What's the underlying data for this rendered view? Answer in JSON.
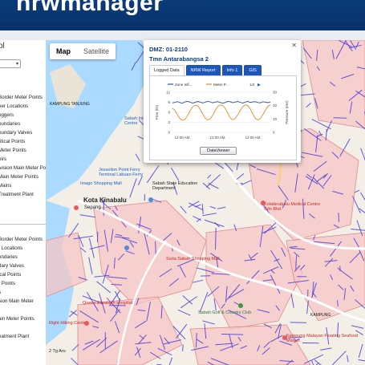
{
  "app": {
    "brand": "nrwmanager"
  },
  "sidebar": {
    "title": "ol",
    "section1": [
      "Border Meter Points",
      "her Locations",
      "oggers",
      "oundaries",
      "oundary Valves",
      "ritical Points",
      "Meter Points",
      "oirs",
      "ivision Main Meter Po",
      "Main Meter Points",
      "Mains",
      "Treatment Plant"
    ],
    "section2": [
      "Border Meter Points",
      "r Locations",
      "undaries",
      "dary Valves",
      "ical Points",
      "r Points",
      "s",
      "sion Main Meter",
      "",
      "ain Meter Points",
      "",
      "eatment Plant"
    ]
  },
  "map": {
    "type_options": [
      "Map",
      "Satellite"
    ],
    "active_type": "Map",
    "labels": {
      "city": "Kota Kinabalu",
      "sepanggar": "Sepang",
      "jesselton": "Jesselton Point Ferry Terminal Labuan Ferry",
      "jesselton2": "Jesselton Point Ferry\nTerminal Labuan Ferry",
      "sabah_convention": "Sabah International Convention Centre",
      "sabah_education": "Sabah State Education Department",
      "imago": "Imago Shopping Mall",
      "medical": "Kotakinabalu Medical Centre Sdn Bhd",
      "kinabalu_park": "Kinabalu Park",
      "golf": "Sabah Golf & Country Club",
      "floating": "Kampung Malayan Floating Seafood Market",
      "kampung_tanjung": "KAMPUNG TANJUNG",
      "tg_aru": "2 Tg Aru",
      "hiking": "Right Hiking Centre",
      "elizabeth": "Queen Elizabeth Hospital",
      "suria": "Suria Sabah Shopping Mall",
      "kampung": "KAMPUNG",
      "mosque": "Bandaraya Mosque"
    }
  },
  "popup": {
    "title": "DMZ: 01-2110",
    "subtitle": "Tmn Antarabangsa 2",
    "tabs": [
      "Logged Data",
      "NRW Report",
      "Info 1",
      "GIS"
    ],
    "active_tab": "Logged Data",
    "close_label": "✕",
    "button_label": "DataViewer",
    "pager": "1/2",
    "chart_data": {
      "type": "line",
      "title": "",
      "x_ticks": [
        "12:00 AM",
        "12:00 AM",
        "12:00 AM"
      ],
      "ylabel_left": "Flow (l/s)",
      "ylabel_right": "Pressure (mH)",
      "ylim_left": [
        0,
        12
      ],
      "ylim_right": [
        0,
        30
      ],
      "left_ticks": [
        "12",
        "9",
        "6",
        "3",
        "0"
      ],
      "right_ticks": [
        "30",
        "20",
        "10",
        "0"
      ],
      "series": [
        {
          "name": "Zone Infl...",
          "color": "#2a4fb8",
          "axis": "right",
          "values": [
            22,
            22.5,
            23,
            22.2,
            21.8,
            22.8,
            23.2,
            22.6,
            21.9,
            22.4,
            23.1,
            22.7,
            22,
            22.5,
            23.3,
            22.8,
            22.1,
            22.6,
            23,
            22.4,
            21.8,
            22.3,
            23.2,
            22.9,
            22.2,
            22.7,
            23.1,
            22.5,
            21.9,
            22.6,
            23.2,
            22.4,
            22.8,
            23,
            22.3,
            22.1,
            22.9,
            22.6,
            22.2,
            22.7
          ]
        },
        {
          "name": "Meter P...",
          "color": "#e6892a",
          "axis": "left",
          "values": [
            7.2,
            6.5,
            5.2,
            4.1,
            3.6,
            3.9,
            5.0,
            6.4,
            7.6,
            8.1,
            8.0,
            7.0,
            5.6,
            4.3,
            3.7,
            4.0,
            5.1,
            6.5,
            7.7,
            8.2,
            8.1,
            7.2,
            5.8,
            4.4,
            3.8,
            4.1,
            5.2,
            6.6,
            7.7,
            8.2,
            8.0,
            7.0,
            5.5,
            4.2,
            3.7,
            4.2,
            5.3,
            6.6,
            7.8,
            8.2
          ]
        }
      ]
    }
  },
  "colors": {
    "header": "#0a3570",
    "map_land": "#f3efe7",
    "water": "#aadaff",
    "zone_fill": "#f6c6c6",
    "pipe": "#4b3bd6"
  }
}
